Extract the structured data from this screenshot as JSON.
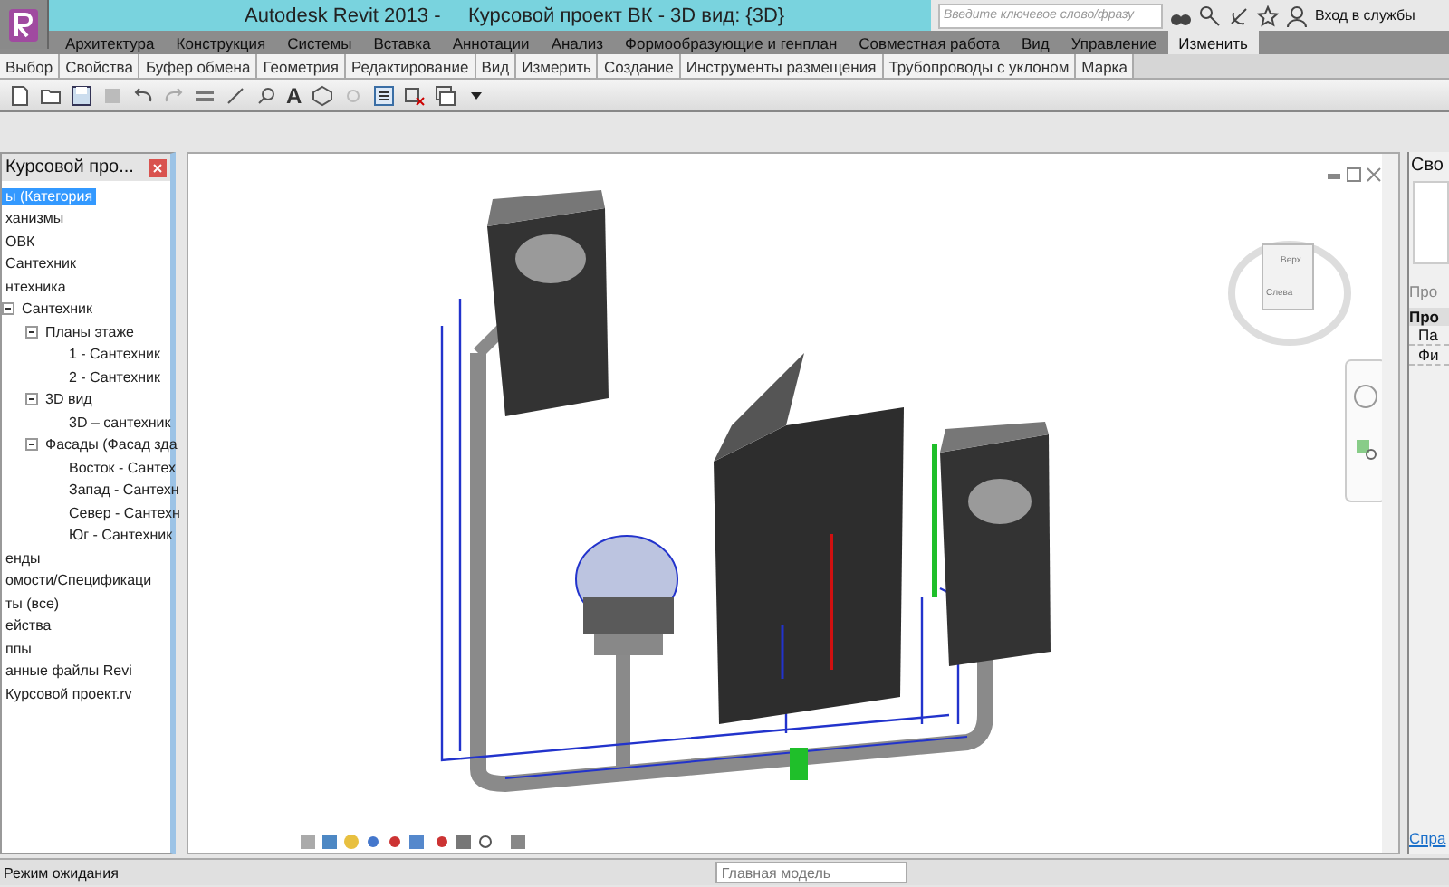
{
  "window": {
    "title": "Autodesk Revit 2013 -     Курсовой проект ВК - 3D вид: {3D}"
  },
  "search": {
    "placeholder": "Введите ключевое слово/фразу"
  },
  "sign_in": "Вход в службы",
  "tabs": [
    {
      "label": "Архитектура",
      "selected": false
    },
    {
      "label": "Конструкция",
      "selected": false
    },
    {
      "label": "Системы",
      "selected": false
    },
    {
      "label": "Вставка",
      "selected": false
    },
    {
      "label": "Аннотации",
      "selected": false
    },
    {
      "label": "Анализ",
      "selected": false
    },
    {
      "label": "Формообразующие и генплан",
      "selected": false
    },
    {
      "label": "Совместная работа",
      "selected": false
    },
    {
      "label": "Вид",
      "selected": false
    },
    {
      "label": "Управление",
      "selected": false
    },
    {
      "label": "Изменить",
      "selected": true
    }
  ],
  "panels": [
    "Выбор",
    "Свойства",
    "Буфер обмена",
    "Геометрия",
    "Редактирование",
    "Вид",
    "Измерить",
    "Создание",
    "Инструменты размещения",
    "Трубопроводы с уклоном",
    "Марка"
  ],
  "quick_access": {
    "text_tool": "A"
  },
  "browser": {
    "title": "Курсовой про...",
    "tree": [
      {
        "label": "ы (Категория",
        "selected": true
      },
      {
        "label": "ханизмы",
        "selected": false
      },
      {
        "label": "ОВК",
        "selected": false
      },
      {
        "label": "Сантехник",
        "selected": false
      },
      {
        "label": "нтехника",
        "selected": false
      },
      {
        "label": "Сантехник",
        "selected": false,
        "expanded": true,
        "children": [
          {
            "label": "Планы этаже",
            "selected": false,
            "expanded": true,
            "children": [
              {
                "label": "1 - Сантехник",
                "selected": false
              },
              {
                "label": "2 - Сантехник",
                "selected": false
              }
            ]
          },
          {
            "label": "3D вид",
            "selected": false,
            "expanded": true,
            "children": [
              {
                "label": "3D – сантехник",
                "selected": false
              }
            ]
          },
          {
            "label": "Фасады (Фасад зда",
            "selected": false,
            "expanded": true,
            "children": [
              {
                "label": "Восток - Сантех",
                "selected": false
              },
              {
                "label": "Запад - Сантехн",
                "selected": false
              },
              {
                "label": "Север - Сантехн",
                "selected": false
              },
              {
                "label": "Юг - Сантехник",
                "selected": false
              }
            ]
          }
        ]
      },
      {
        "label": "енды",
        "selected": false
      },
      {
        "label": "омости/Спецификаци",
        "selected": false
      },
      {
        "label": "ты (все)",
        "selected": false
      },
      {
        "label": "ейства",
        "selected": false
      },
      {
        "label": "ппы",
        "selected": false
      },
      {
        "label": "анные файлы Revi",
        "selected": false
      },
      {
        "label": "Курсовой проект.rv",
        "selected": false
      }
    ]
  },
  "viewcube": {
    "front": "Слева",
    "top": "Верх"
  },
  "properties": {
    "title": "Сво",
    "filter": "Про",
    "group": "Про",
    "rows": [
      "Па",
      "Фи"
    ],
    "help_link": "Спра"
  },
  "status_bar": {
    "text": "Режим ожидания",
    "workset": "Главная модель"
  }
}
